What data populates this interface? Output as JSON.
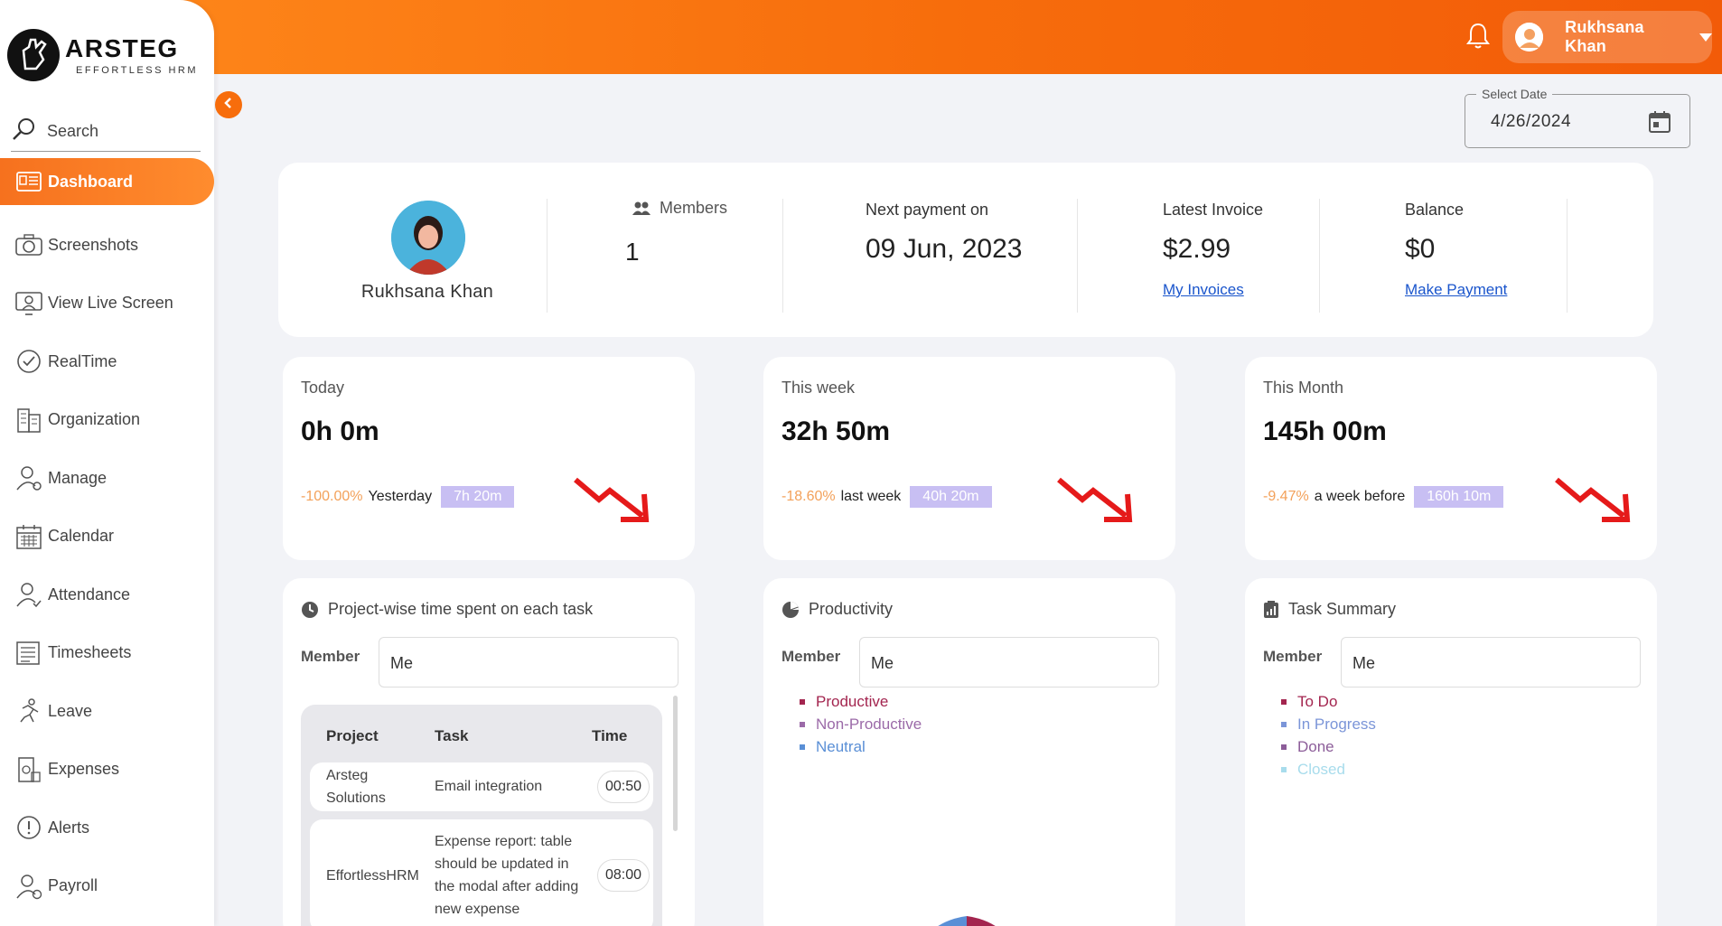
{
  "brand": {
    "name": "ARSTEG",
    "tagline": "EFFORTLESS HRM"
  },
  "header": {
    "user_name": "Rukhsana Khan"
  },
  "sidebar": {
    "search_label": "Search",
    "items": [
      {
        "label": "Dashboard",
        "icon": "dashboard-icon",
        "active": true
      },
      {
        "label": "Screenshots",
        "icon": "camera-icon"
      },
      {
        "label": "View Live Screen",
        "icon": "monitor-user-icon"
      },
      {
        "label": "RealTime",
        "icon": "check-circle-icon"
      },
      {
        "label": "Organization",
        "icon": "building-icon"
      },
      {
        "label": "Manage",
        "icon": "user-gear-icon"
      },
      {
        "label": "Calendar",
        "icon": "calendar-icon"
      },
      {
        "label": "Attendance",
        "icon": "user-check-icon"
      },
      {
        "label": "Timesheets",
        "icon": "document-lines-icon"
      },
      {
        "label": "Leave",
        "icon": "running-person-icon"
      },
      {
        "label": "Expenses",
        "icon": "receipt-icon"
      },
      {
        "label": "Alerts",
        "icon": "exclamation-icon"
      },
      {
        "label": "Payroll",
        "icon": "user-dollar-icon"
      }
    ]
  },
  "date_picker": {
    "legend": "Select Date",
    "value": "4/26/2024"
  },
  "summary": {
    "person_name": "Rukhsana Khan",
    "members_label": "Members",
    "members_value": "1",
    "next_payment_label": "Next payment on",
    "next_payment_value": "09 Jun, 2023",
    "latest_invoice_label": "Latest Invoice",
    "latest_invoice_value": "$2.99",
    "latest_invoice_link": "My Invoices",
    "balance_label": "Balance",
    "balance_value": "$0",
    "balance_link": "Make Payment"
  },
  "stats": [
    {
      "label": "Today",
      "value": "0h 0m",
      "pct": "-100.00%",
      "compare": "Yesterday",
      "badge": "7h 20m"
    },
    {
      "label": "This week",
      "value": "32h 50m",
      "pct": "-18.60%",
      "compare": "last week",
      "badge": "40h 20m"
    },
    {
      "label": "This Month",
      "value": "145h 00m",
      "pct": "-9.47%",
      "compare": "a week before",
      "badge": "160h 10m"
    }
  ],
  "project_widget": {
    "title": "Project-wise time spent on each task",
    "member_label": "Member",
    "member_value": "Me",
    "columns": [
      "Project",
      "Task",
      "Time"
    ],
    "rows": [
      {
        "project": "Arsteg Solutions",
        "task": "Email integration",
        "time": "00:50"
      },
      {
        "project": "EffortlessHRM",
        "task": "Expense report: table should be updated in the modal after adding new expense",
        "time": "08:00"
      }
    ]
  },
  "productivity_widget": {
    "title": "Productivity",
    "member_label": "Member",
    "member_value": "Me",
    "legend": [
      {
        "label": "Productive",
        "color": "#a3254f"
      },
      {
        "label": "Non-Productive",
        "color": "#9b6aa8"
      },
      {
        "label": "Neutral",
        "color": "#5a8fd6"
      }
    ]
  },
  "task_widget": {
    "title": "Task Summary",
    "member_label": "Member",
    "member_value": "Me",
    "legend": [
      {
        "label": "To Do",
        "color": "#a3254f"
      },
      {
        "label": "In Progress",
        "color": "#7b95d8"
      },
      {
        "label": "Done",
        "color": "#8c5d99"
      },
      {
        "label": "Closed",
        "color": "#a8dcec"
      }
    ]
  },
  "colors": {
    "accent": "#f76d0c",
    "badge": "#c8bff3",
    "trend_down": "#e51a1a"
  }
}
